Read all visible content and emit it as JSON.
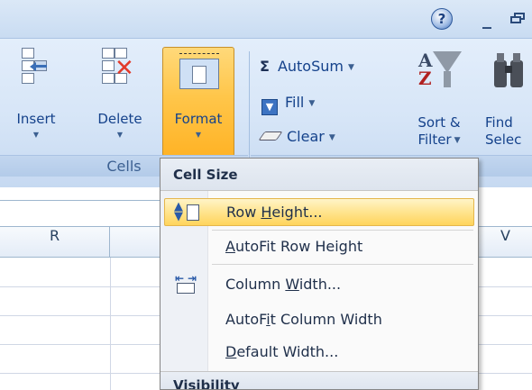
{
  "ribbon": {
    "cells_group": {
      "label": "Cells",
      "insert": {
        "label": "Insert",
        "icon": "insert-cells-icon"
      },
      "delete": {
        "label": "Delete",
        "icon": "delete-cells-icon"
      },
      "format": {
        "label": "Format",
        "icon": "format-cells-icon",
        "state": "pressed"
      }
    },
    "editing_group": {
      "autosum": {
        "label": "AutoSum",
        "icon": "sigma-icon"
      },
      "fill": {
        "label": "Fill",
        "icon": "fill-down-icon"
      },
      "clear": {
        "label": "Clear",
        "icon": "eraser-icon"
      },
      "sort_filter": {
        "line1": "Sort &",
        "line2": "Filter",
        "icon": "sort-filter-icon"
      },
      "find_select": {
        "line1": "Find",
        "line2": "Selec",
        "icon": "binoculars-icon"
      }
    }
  },
  "window": {
    "help": "?",
    "minimize": "_"
  },
  "columns": {
    "r": "R",
    "v": "V"
  },
  "format_menu": {
    "section_cell_size": "Cell Size",
    "items": [
      {
        "pre": "Row ",
        "key": "H",
        "post": "eight...",
        "icon": "row-height-icon",
        "highlighted": true
      },
      {
        "pre": "",
        "key": "A",
        "post": "utoFit Row Height",
        "icon": "",
        "highlighted": false
      },
      {
        "pre": "Column ",
        "key": "W",
        "post": "idth...",
        "icon": "column-width-icon",
        "highlighted": false
      },
      {
        "pre": "AutoF",
        "key": "i",
        "post": "t Column Width",
        "icon": "",
        "highlighted": false
      },
      {
        "pre": "",
        "key": "D",
        "post": "efault Width...",
        "icon": "",
        "highlighted": false
      }
    ],
    "section_visibility": "Visibility"
  },
  "colors": {
    "ribbon": "#d6e5f7",
    "highlight": "#ffe48e",
    "text": "#15428b"
  }
}
